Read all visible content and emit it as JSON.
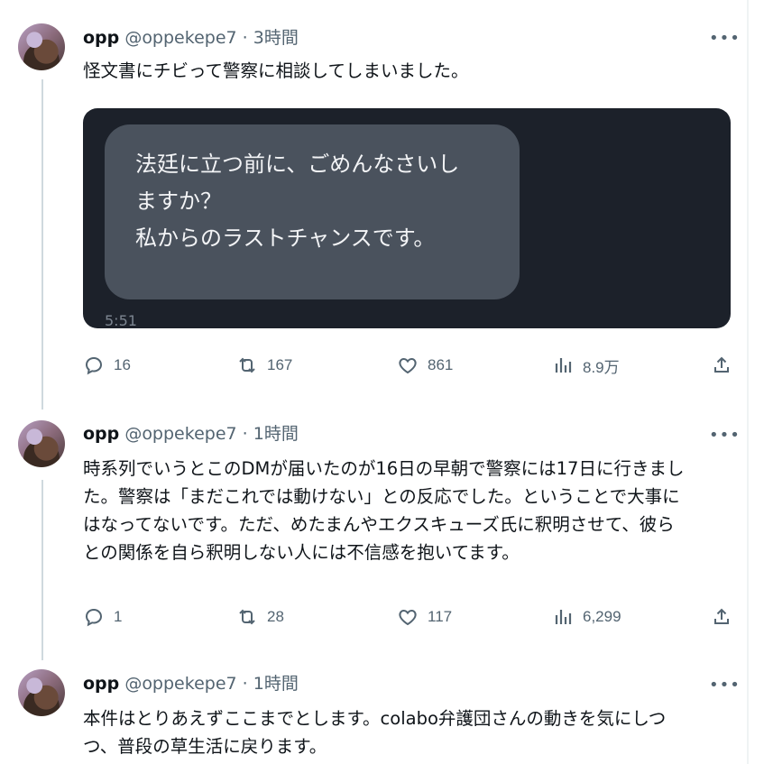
{
  "tweets": [
    {
      "name": "opp",
      "handle": "@oppekepe7",
      "sep": "·",
      "time": "3時間",
      "more": "•••",
      "text": [
        "怪文書にチビって警察に相談してしまいました。"
      ],
      "media": {
        "lines": [
          "法廷に立つ前に、ごめんなさいし",
          "ますか？",
          "私からのラストチャンスです。"
        ],
        "timestamp": "5:51"
      },
      "replies": "16",
      "retweets": "167",
      "likes": "861",
      "views": "8.9万"
    },
    {
      "name": "opp",
      "handle": "@oppekepe7",
      "sep": "·",
      "time": "1時間",
      "more": "•••",
      "text": [
        "時系列でいうとこのDMが届いたのが16日の早朝で警察には17日に行きまし",
        "た。警察は「まだこれでは動けない」との反応でした。ということで大事に",
        "はなってないです。ただ、めたまんやエクスキューズ氏に釈明させて、彼ら",
        "との関係を自ら釈明しない人には不信感を抱いてます。"
      ],
      "replies": "1",
      "retweets": "28",
      "likes": "117",
      "views": "6,299"
    },
    {
      "name": "opp",
      "handle": "@oppekepe7",
      "sep": "·",
      "time": "1時間",
      "more": "•••",
      "text": [
        "本件はとりあえずここまでとします。colabo弁護団さんの動きを気にしつ",
        "つ、普段の草生活に戻ります。"
      ]
    }
  ],
  "icons": [
    "reply-icon",
    "retweet-icon",
    "like-icon",
    "views-icon",
    "share-icon",
    "more-icon",
    "avatar"
  ],
  "colors": {
    "text": "#0f1419",
    "muted": "#536471",
    "thread_line": "#cfd9de",
    "media_bg": "#1c212a",
    "bubble": "#4a525d"
  }
}
